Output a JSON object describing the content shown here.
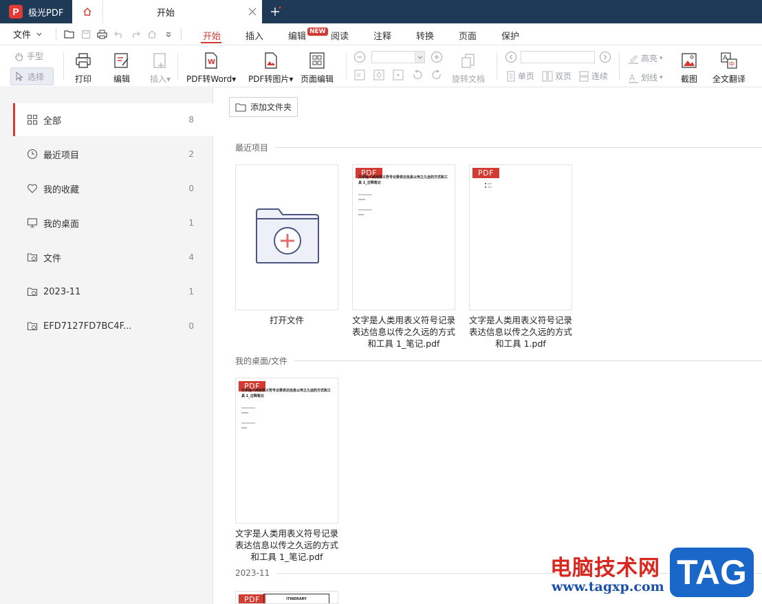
{
  "titlebar": {
    "app_name": "极光PDF",
    "logo_letter": "P",
    "tab_title": "开始"
  },
  "menubar": {
    "file": "文件",
    "tabs": [
      "开始",
      "插入",
      "编辑",
      "阅读",
      "注释",
      "转换",
      "页面",
      "保护"
    ],
    "new_badge": "NEW"
  },
  "toolbar": {
    "hand": "手型",
    "select": "选择",
    "print": "打印",
    "edit": "编辑",
    "insert": "插入",
    "pdf_to_word": "PDF转Word",
    "pdf_to_image": "PDF转图片",
    "page_edit": "页面编辑",
    "rotate_doc": "旋转文档",
    "single": "单页",
    "double": "双页",
    "continuous": "连续",
    "highlight": "高亮",
    "strikeout": "划线",
    "screenshot": "截图",
    "translate": "全文翻译"
  },
  "sidebar": {
    "items": [
      {
        "label": "全部",
        "count": "8"
      },
      {
        "label": "最近项目",
        "count": "2"
      },
      {
        "label": "我的收藏",
        "count": "0"
      },
      {
        "label": "我的桌面",
        "count": "1"
      },
      {
        "label": "文件",
        "count": "4"
      },
      {
        "label": "2023-11",
        "count": "1"
      },
      {
        "label": "EFD7127FD7BC4F...",
        "count": "0"
      }
    ]
  },
  "main": {
    "add_folder": "添加文件夹",
    "sections": [
      {
        "title": "最近项目"
      },
      {
        "title": "我的桌面/文件"
      },
      {
        "title": "2023-11"
      }
    ],
    "pdf_tag": "PDF",
    "open_file": "打开文件",
    "files": [
      {
        "line1": "文字是人类用表义符号记录",
        "line2": "表达信息以传之久远的方式",
        "line3": "和工具 1_笔记.pdf"
      },
      {
        "line1": "文字是人类用表义符号记录",
        "line2": "表达信息以传之久远的方式",
        "line3": "和工具 1.pdf"
      },
      {
        "line1": "文字是人类用表义符号记录",
        "line2": "表达信息以传之久远的方式",
        "line3": "和工具 1_笔记.pdf"
      }
    ],
    "thumb_heading": "文字是人类用表义符号记录表达信息以传之久远的方式和工具 1_注释笔记",
    "itinerary": "ITINERARY"
  },
  "watermark": {
    "cn": "电脑技术网",
    "url": "www.tagxp.com",
    "tag": "TAG"
  },
  "colors": {
    "titlebar": "#1f3a56",
    "accent": "#d33a31",
    "sidebar_bg": "#f4f4f4",
    "folder_fill": "#eef0f8",
    "folder_stroke": "#4b5680"
  }
}
